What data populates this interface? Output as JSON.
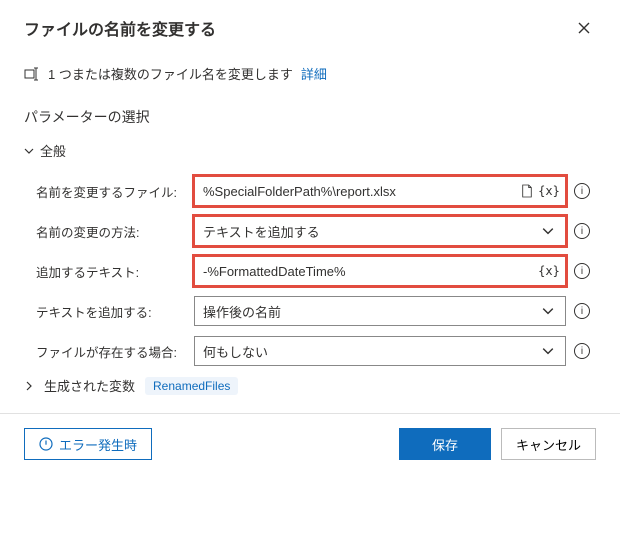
{
  "header": {
    "title": "ファイルの名前を変更する"
  },
  "info": {
    "text": "1 つまたは複数のファイル名を変更します ",
    "link": "詳細"
  },
  "params_section_title": "パラメーターの選択",
  "general": {
    "label": "全般",
    "fields": {
      "file": {
        "label": "名前を変更するファイル:",
        "value": "%SpecialFolderPath%\\report.xlsx"
      },
      "method": {
        "label": "名前の変更の方法:",
        "value": "テキストを追加する"
      },
      "text": {
        "label": "追加するテキスト:",
        "value": "-%FormattedDateTime%"
      },
      "position": {
        "label": "テキストを追加する:",
        "value": "操作後の名前"
      },
      "exists": {
        "label": "ファイルが存在する場合:",
        "value": "何もしない"
      }
    }
  },
  "generated_vars": {
    "label": "生成された変数",
    "badge": "RenamedFiles"
  },
  "footer": {
    "error": "エラー発生時",
    "save": "保存",
    "cancel": "キャンセル"
  }
}
